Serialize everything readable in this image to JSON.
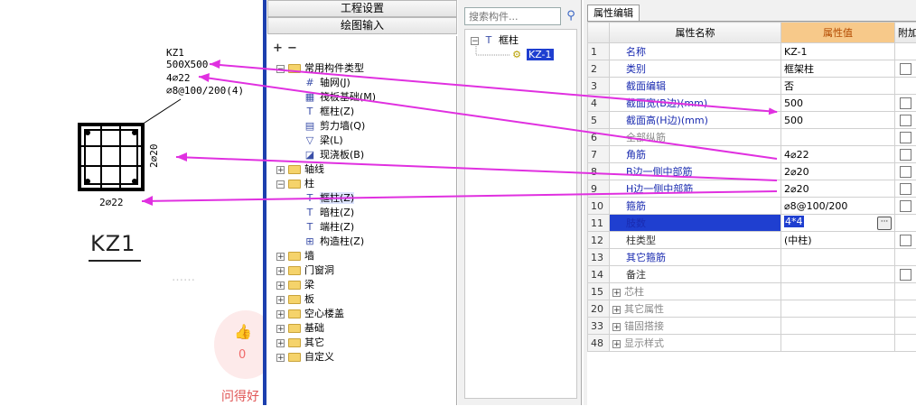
{
  "drawing": {
    "annotation_lines": [
      "KZ1",
      "500X500",
      "4⌀22",
      "⌀8@100/200(4)"
    ],
    "right_label": "2⌀20",
    "bottom_label": "2⌀22",
    "big_title": "KZ1",
    "like_count": "0",
    "footer_text": "问得好",
    "blur_text": "……"
  },
  "top_buttons": [
    "工程设置",
    "绘图输入"
  ],
  "tree": {
    "tool_add": "+",
    "tool_remove": "−",
    "items": [
      {
        "label": "常用构件类型",
        "level": 0,
        "expand": "−",
        "icon": "folder-icon"
      },
      {
        "label": "轴网(J)",
        "level": 1,
        "icon": "grid-icon"
      },
      {
        "label": "筏板基础(M)",
        "level": 1,
        "icon": "raft-foundation-icon"
      },
      {
        "label": "框柱(Z)",
        "level": 1,
        "icon": "column-icon"
      },
      {
        "label": "剪力墙(Q)",
        "level": 1,
        "icon": "shear-wall-icon"
      },
      {
        "label": "梁(L)",
        "level": 1,
        "icon": "beam-icon"
      },
      {
        "label": "现浇板(B)",
        "level": 1,
        "icon": "slab-icon"
      },
      {
        "label": "轴线",
        "level": 0,
        "expand": "+",
        "icon": "folder-icon"
      },
      {
        "label": "柱",
        "level": 0,
        "expand": "−",
        "icon": "folder-icon"
      },
      {
        "label": "框柱(Z)",
        "level": 1,
        "icon": "column-icon"
      },
      {
        "label": "暗柱(Z)",
        "level": 1,
        "icon": "column-icon"
      },
      {
        "label": "端柱(Z)",
        "level": 1,
        "icon": "column-icon"
      },
      {
        "label": "构造柱(Z)",
        "level": 1,
        "icon": "construction-column-icon"
      },
      {
        "label": "墙",
        "level": 0,
        "expand": "+",
        "icon": "folder-icon"
      },
      {
        "label": "门窗洞",
        "level": 0,
        "expand": "+",
        "icon": "folder-icon"
      },
      {
        "label": "梁",
        "level": 0,
        "expand": "+",
        "icon": "folder-icon"
      },
      {
        "label": "板",
        "level": 0,
        "expand": "+",
        "icon": "folder-icon"
      },
      {
        "label": "空心楼盖",
        "level": 0,
        "expand": "+",
        "icon": "folder-icon"
      },
      {
        "label": "基础",
        "level": 0,
        "expand": "+",
        "icon": "folder-icon"
      },
      {
        "label": "其它",
        "level": 0,
        "expand": "+",
        "icon": "folder-icon"
      },
      {
        "label": "自定义",
        "level": 0,
        "expand": "+",
        "icon": "folder-icon"
      }
    ]
  },
  "component_list": {
    "search_placeholder": "搜索构件...",
    "root_label": "框柱",
    "root_expand": "−",
    "selected_item": "KZ-1"
  },
  "properties": {
    "tab_label": "属性编辑",
    "headers": [
      "",
      "属性名称",
      "属性值",
      "附加"
    ],
    "rows": [
      {
        "num": "1",
        "name": "名称",
        "value": "KZ-1",
        "style": "blue",
        "check": false
      },
      {
        "num": "2",
        "name": "类别",
        "value": "框架柱",
        "style": "blue",
        "check": true
      },
      {
        "num": "3",
        "name": "截面编辑",
        "value": "否",
        "style": "blue",
        "check": false
      },
      {
        "num": "4",
        "name": "截面宽(B边)(mm)",
        "value": "500",
        "style": "blue",
        "check": true
      },
      {
        "num": "5",
        "name": "截面高(H边)(mm)",
        "value": "500",
        "style": "blue",
        "check": true
      },
      {
        "num": "6",
        "name": "全部纵筋",
        "value": "",
        "style": "gray",
        "check": true
      },
      {
        "num": "7",
        "name": "角筋",
        "value": "4⌀22",
        "style": "blue",
        "check": true
      },
      {
        "num": "8",
        "name": "B边一侧中部筋",
        "value": "2⌀20",
        "style": "blue",
        "check": true
      },
      {
        "num": "9",
        "name": "H边一侧中部筋",
        "value": "2⌀20",
        "style": "blue",
        "check": true
      },
      {
        "num": "10",
        "name": "箍筋",
        "value": "⌀8@100/200",
        "style": "blue",
        "check": true
      },
      {
        "num": "11",
        "name": "肢数",
        "value": "4*4",
        "style": "selected",
        "check": false
      },
      {
        "num": "12",
        "name": "柱类型",
        "value": "(中柱)",
        "style": "dark",
        "check": true
      },
      {
        "num": "13",
        "name": "其它箍筋",
        "value": "",
        "style": "blue",
        "check": false
      },
      {
        "num": "14",
        "name": "备注",
        "value": "",
        "style": "dark",
        "check": true
      },
      {
        "num": "15",
        "name": "芯柱",
        "value": "",
        "style": "group",
        "check": false
      },
      {
        "num": "20",
        "name": "其它属性",
        "value": "",
        "style": "group",
        "check": false
      },
      {
        "num": "33",
        "name": "锚固搭接",
        "value": "",
        "style": "group",
        "check": false
      },
      {
        "num": "48",
        "name": "显示样式",
        "value": "",
        "style": "group",
        "check": false
      }
    ]
  },
  "colors": {
    "arrow": "#e030e0",
    "divider": "#1c3fae",
    "selection": "#1f3fd0",
    "value_header": "#f7c98a"
  }
}
